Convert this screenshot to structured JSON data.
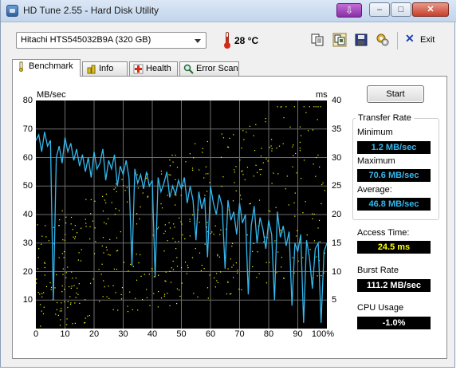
{
  "window": {
    "title": "HD Tune 2.55 - Hard Disk Utility",
    "min_glyph": "–",
    "max_glyph": "□",
    "close_glyph": "✕",
    "purple_glyph": "⇩"
  },
  "toolbar": {
    "drive": "Hitachi HTS545032B9A (320 GB)",
    "temperature": "28 °C",
    "exit_label": "Exit",
    "icons": [
      "copy-info-icon",
      "copy-screen-icon",
      "save-icon",
      "options-icon",
      "exit-icon"
    ]
  },
  "tabs": [
    {
      "label": "Benchmark",
      "icon": "benchmark-icon",
      "active": true
    },
    {
      "label": "Info",
      "icon": "info-icon",
      "active": false
    },
    {
      "label": "Health",
      "icon": "health-icon",
      "active": false
    },
    {
      "label": "Error Scan",
      "icon": "error-scan-icon",
      "active": false
    }
  ],
  "start_button": "Start",
  "transfer_rate": {
    "title": "Transfer Rate",
    "minimum_label": "Minimum",
    "minimum": "1.2 MB/sec",
    "maximum_label": "Maximum",
    "maximum": "70.6 MB/sec",
    "average_label": "Average:",
    "average": "46.8 MB/sec"
  },
  "access_time": {
    "label": "Access Time:",
    "value": "24.5 ms"
  },
  "burst_rate": {
    "label": "Burst Rate",
    "value": "111.2 MB/sec"
  },
  "cpu_usage": {
    "label": "CPU Usage",
    "value": "-1.0%"
  },
  "colors": {
    "transfer_line": "#34b8ee",
    "access_points": "#ffff00",
    "grid": "#6c6c6c",
    "plot_bg": "#000000"
  },
  "chart_data": {
    "type": "line",
    "ylabel_left": "MB/sec",
    "ylabel_right": "ms",
    "y_left_range": [
      0,
      80
    ],
    "y_right_range": [
      0,
      40
    ],
    "x_range": [
      0,
      100
    ],
    "y_left_ticks": [
      80,
      70,
      60,
      50,
      40,
      30,
      20,
      10
    ],
    "y_right_ticks": [
      40,
      35,
      30,
      25,
      20,
      15,
      10,
      5
    ],
    "x_ticks": [
      "0",
      "10",
      "20",
      "30",
      "40",
      "50",
      "60",
      "70",
      "80",
      "90",
      "100%"
    ],
    "grid": true,
    "series": [
      {
        "name": "Transfer Rate",
        "axis": "left",
        "x": [
          0,
          1,
          2,
          3,
          4,
          5,
          6,
          7,
          8,
          9,
          10,
          11,
          12,
          13,
          14,
          15,
          16,
          17,
          18,
          19,
          20,
          21,
          22,
          23,
          24,
          25,
          26,
          27,
          28,
          29,
          30,
          31,
          32,
          33,
          34,
          35,
          36,
          37,
          38,
          39,
          40,
          41,
          42,
          43,
          44,
          45,
          46,
          47,
          48,
          49,
          50,
          51,
          52,
          53,
          54,
          55,
          56,
          57,
          58,
          59,
          60,
          61,
          62,
          63,
          64,
          65,
          66,
          67,
          68,
          69,
          70,
          71,
          72,
          73,
          74,
          75,
          76,
          77,
          78,
          79,
          80,
          81,
          82,
          83,
          84,
          85,
          86,
          87,
          88,
          89,
          90,
          91,
          92,
          93,
          94,
          95,
          96,
          97,
          98,
          99,
          100
        ],
        "y": [
          66,
          68,
          62,
          69,
          64,
          66,
          10,
          60,
          64,
          58,
          67,
          62,
          65,
          59,
          63,
          57,
          61,
          55,
          60,
          53,
          62,
          56,
          58,
          63,
          52,
          59,
          56,
          61,
          50,
          57,
          54,
          59,
          53,
          22,
          56,
          51,
          54,
          49,
          55,
          50,
          52,
          18,
          53,
          48,
          51,
          55,
          46,
          50,
          47,
          52,
          49,
          53,
          44,
          50,
          45,
          31,
          48,
          42,
          46,
          25,
          50,
          44,
          40,
          47,
          43,
          21,
          45,
          38,
          41,
          33,
          44,
          37,
          40,
          12,
          36,
          43,
          30,
          39,
          35,
          28,
          38,
          33,
          10,
          41,
          32,
          36,
          29,
          34,
          8,
          30,
          27,
          33,
          2,
          31,
          25,
          14,
          28,
          30,
          2,
          27,
          30
        ]
      }
    ],
    "access_points_note": "yellow scatter of random access times (ms, right axis)"
  }
}
